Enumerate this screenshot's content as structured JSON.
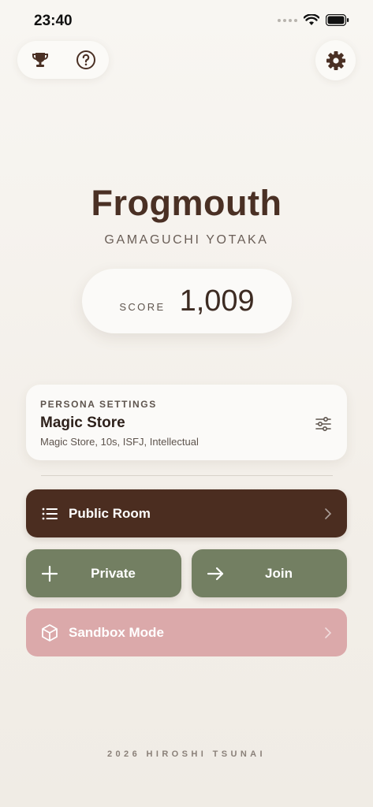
{
  "status_bar": {
    "time": "23:40"
  },
  "header": {
    "trophy_icon": "trophy-icon",
    "help_icon": "question-circle-icon",
    "settings_icon": "gear-icon"
  },
  "title": {
    "name": "Frogmouth",
    "subtitle": "GAMAGUCHI YOTAKA"
  },
  "score": {
    "label": "SCORE",
    "value": "1,009"
  },
  "persona": {
    "label": "PERSONA SETTINGS",
    "name": "Magic Store",
    "description": "Magic Store, 10s, ISFJ, Intellectual",
    "icon": "sliders-icon"
  },
  "actions": {
    "public_room": {
      "label": "Public Room",
      "icon": "list-icon",
      "color": "#4b2d20"
    },
    "private": {
      "label": "Private",
      "icon": "plus-icon",
      "color": "#737f62"
    },
    "join": {
      "label": "Join",
      "icon": "arrow-right-icon",
      "color": "#737f62"
    },
    "sandbox": {
      "label": "Sandbox Mode",
      "icon": "cube-icon",
      "color": "#dba9aa"
    }
  },
  "footer": {
    "text": "2026 HIROSHI TSUNAI"
  }
}
